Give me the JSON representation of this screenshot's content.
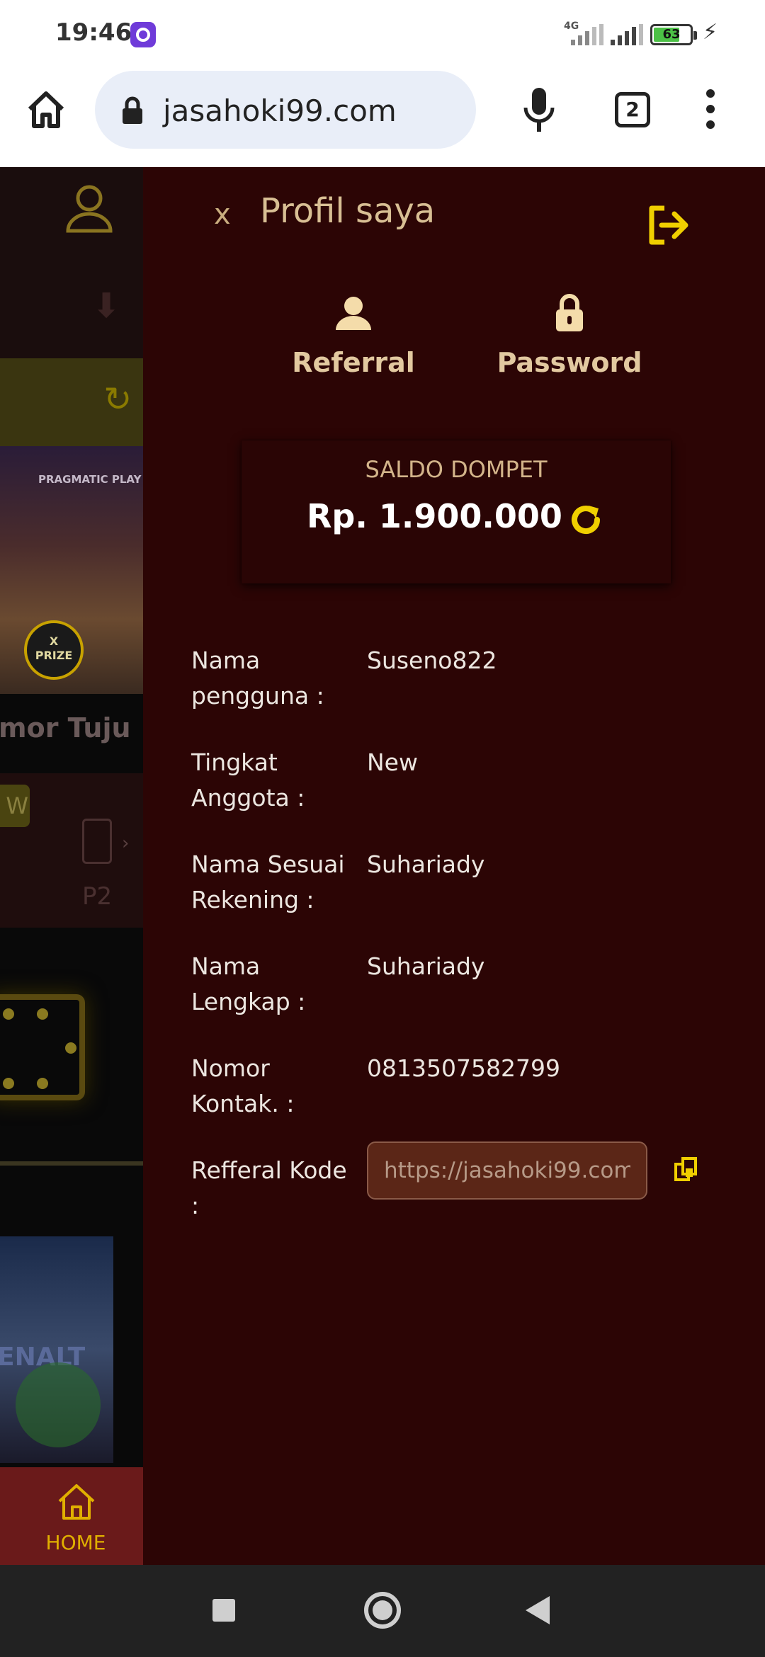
{
  "status_bar": {
    "time": "19:46",
    "network": "4G",
    "battery": "63"
  },
  "browser": {
    "url": "jasahoki99.com",
    "tab_count": "2"
  },
  "background_site": {
    "pragmatic_label": "PRAGMATIC PLAY",
    "prize_badge": "PRIZE",
    "section_title": "mor Tuju",
    "new_tag": "W",
    "card_label": "P2",
    "game_banner": "ENALT",
    "home_label": "HOME"
  },
  "panel": {
    "close_label": "x",
    "title": "Profil saya",
    "tabs": [
      {
        "label": "Referral"
      },
      {
        "label": "Password"
      }
    ],
    "wallet": {
      "label": "SALDO DOMPET",
      "amount": "Rp. 1.900.000"
    },
    "fields": [
      {
        "label": "Nama pengguna :",
        "value": "Suseno822"
      },
      {
        "label": "Tingkat Anggota :",
        "value": "New"
      },
      {
        "label": "Nama Sesuai Rekening :",
        "value": "Suhariady"
      },
      {
        "label": "Nama Lengkap :",
        "value": "Suhariady"
      },
      {
        "label": "Nomor Kontak. :",
        "value": "0813507582799"
      },
      {
        "label": "Refferal Kode :",
        "value": "https://jasahoki99.com"
      }
    ]
  },
  "colors": {
    "panel_bg": "#2c0505",
    "accent_yellow": "#f0cf00",
    "label_tan": "#d8bf94"
  }
}
